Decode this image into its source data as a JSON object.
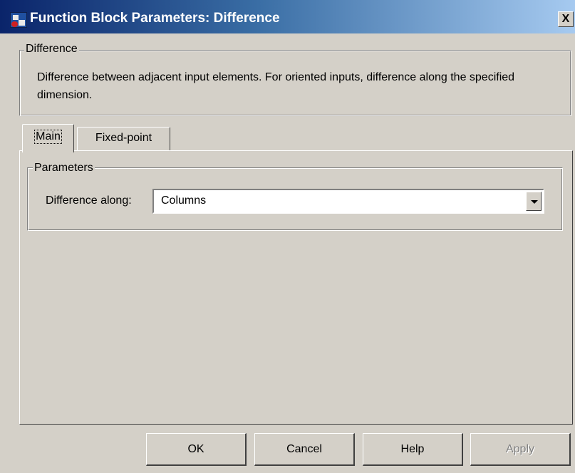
{
  "window": {
    "title": "Function Block Parameters: Difference",
    "close_label": "X"
  },
  "description": {
    "group_title": "Difference",
    "text": "Difference between adjacent input elements.  For oriented inputs, difference along the specified dimension."
  },
  "tabs": [
    {
      "label": "Main",
      "selected": true
    },
    {
      "label": "Fixed-point",
      "selected": false
    }
  ],
  "parameters": {
    "group_title": "Parameters",
    "difference_along": {
      "label": "Difference along:",
      "value": "Columns"
    }
  },
  "buttons": {
    "ok": "OK",
    "cancel": "Cancel",
    "help": "Help",
    "apply": "Apply",
    "apply_enabled": false
  },
  "colors": {
    "titlebar_start": "#0a246a",
    "titlebar_end": "#a6caf0",
    "dialog_bg": "#d4d0c8"
  }
}
